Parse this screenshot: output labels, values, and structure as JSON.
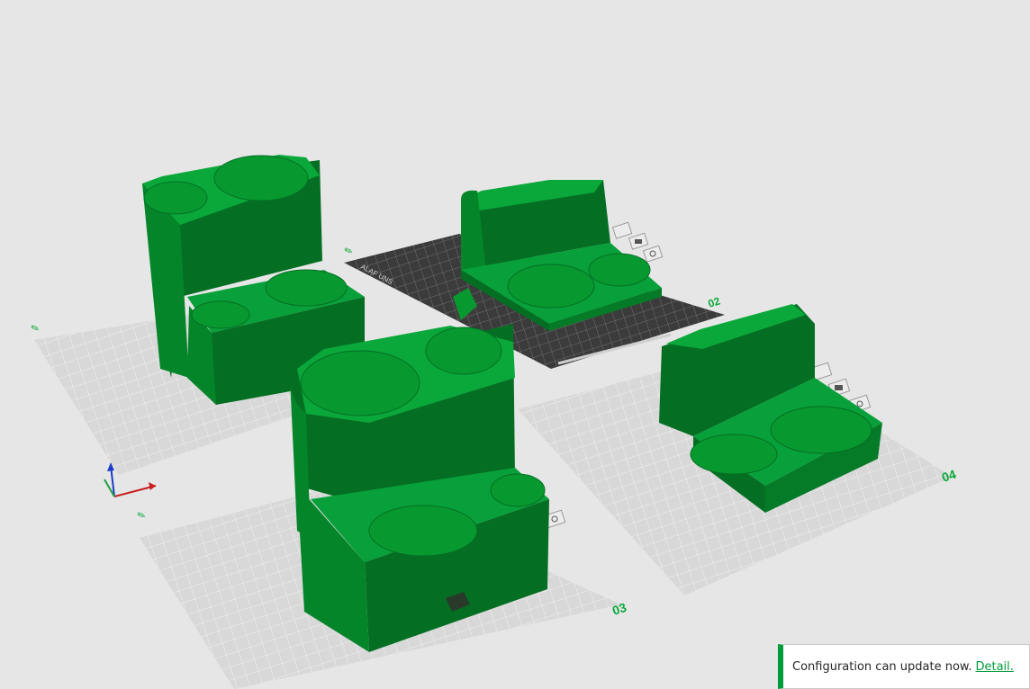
{
  "viewport": {
    "background": "#e6e6e6",
    "plates": [
      {
        "label": "01",
        "label_visible": false
      },
      {
        "label": "02",
        "label_visible": true
      },
      {
        "label": "03",
        "label_visible": true
      },
      {
        "label": "04",
        "label_visible": true
      }
    ],
    "active_plate_label": "02",
    "bed_text": "ALAF UNS"
  },
  "colors": {
    "model": "#06952f",
    "model_dark": "#046e23",
    "model_light": "#0aa83a",
    "plate_inactive": "#d7d7d7",
    "plate_active": "#3a3a3a",
    "accent": "#009b3a"
  },
  "icons": [
    "plate-lock-icon",
    "plate-arrange-icon",
    "plate-settings-icon",
    "axis-gizmo-icon",
    "plate-edit-icon"
  ],
  "notification": {
    "message": "Configuration can update now.",
    "link": "Detail."
  }
}
